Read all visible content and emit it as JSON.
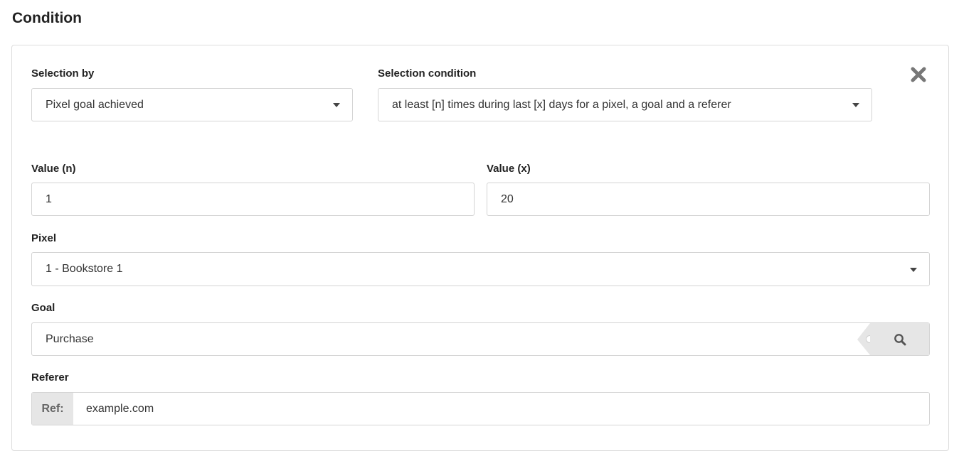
{
  "page": {
    "title": "Condition"
  },
  "condition": {
    "selection_by": {
      "label": "Selection by",
      "value": "Pixel goal achieved"
    },
    "selection_condition": {
      "label": "Selection condition",
      "value": "at least [n] times during last [x] days for a pixel, a goal and a referer"
    },
    "value_n": {
      "label": "Value (n)",
      "value": "1"
    },
    "value_x": {
      "label": "Value (x)",
      "value": "20"
    },
    "pixel": {
      "label": "Pixel",
      "value": "1 - Bookstore 1"
    },
    "goal": {
      "label": "Goal",
      "value": "Purchase"
    },
    "referer": {
      "label": "Referer",
      "prefix": "Ref:",
      "value": "example.com"
    }
  },
  "icons": {
    "close": "close-icon",
    "search": "search-icon",
    "dropdown": "caret-down-icon"
  }
}
